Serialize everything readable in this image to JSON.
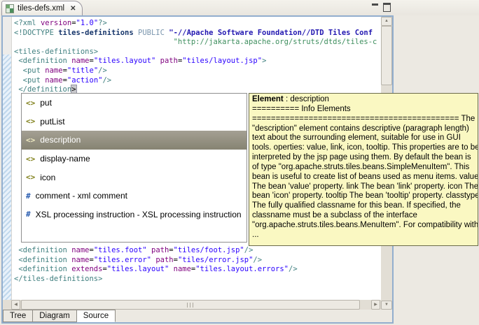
{
  "window": {
    "tab": {
      "title": "tiles-defs.xml",
      "close_glyph": "✕"
    }
  },
  "editor": {
    "lines_top": [
      [
        [
          "tag",
          "<?xml "
        ],
        [
          "attr",
          "version"
        ],
        [
          "pln",
          "="
        ],
        [
          "val",
          "\"1.0\""
        ],
        [
          "tag",
          "?>"
        ]
      ],
      [
        [
          "tag",
          "<!DOCTYPE "
        ],
        [
          "dtn",
          "tiles-definitions"
        ],
        [
          "pln",
          " "
        ],
        [
          "kw",
          "PUBLIC "
        ],
        [
          "pub",
          "\"-//Apache Software Foundation//DTD Tiles Conf"
        ]
      ],
      [
        [
          "pln",
          "                                    "
        ],
        [
          "sys",
          "\"http://jakarta.apache.org/struts/dtds/tiles-c"
        ]
      ],
      [
        [
          "tag",
          "<tiles-definitions>"
        ]
      ],
      [
        [
          "pln",
          " "
        ],
        [
          "tag",
          "<definition"
        ],
        [
          "attr",
          " name"
        ],
        [
          "pln",
          "="
        ],
        [
          "val",
          "\"tiles.layout\""
        ],
        [
          "attr",
          " path"
        ],
        [
          "pln",
          "="
        ],
        [
          "val",
          "\"tiles/layout.jsp\""
        ],
        [
          "tag",
          ">"
        ]
      ],
      [
        [
          "pln",
          "  "
        ],
        [
          "tag",
          "<put"
        ],
        [
          "attr",
          " name"
        ],
        [
          "pln",
          "="
        ],
        [
          "val",
          "\"title\""
        ],
        [
          "tag",
          "/>"
        ]
      ],
      [
        [
          "pln",
          "  "
        ],
        [
          "tag",
          "<put"
        ],
        [
          "attr",
          " name"
        ],
        [
          "pln",
          "="
        ],
        [
          "val",
          "\"action\""
        ],
        [
          "tag",
          "/>"
        ]
      ],
      [
        [
          "pln",
          " "
        ],
        [
          "tag",
          "</definition"
        ],
        [
          "hl",
          ">"
        ]
      ]
    ],
    "lines_bottom": [
      [
        [
          "pln",
          " "
        ],
        [
          "tag",
          "<definition"
        ],
        [
          "attr",
          " name"
        ],
        [
          "pln",
          "="
        ],
        [
          "val",
          "\"tiles.foot\""
        ],
        [
          "attr",
          " path"
        ],
        [
          "pln",
          "="
        ],
        [
          "val",
          "\"tiles/foot.jsp\""
        ],
        [
          "tag",
          "/>"
        ]
      ],
      [
        [
          "pln",
          " "
        ],
        [
          "tag",
          "<definition"
        ],
        [
          "attr",
          " name"
        ],
        [
          "pln",
          "="
        ],
        [
          "val",
          "\"tiles.error\""
        ],
        [
          "attr",
          " path"
        ],
        [
          "pln",
          "="
        ],
        [
          "val",
          "\"tiles/error.jsp\""
        ],
        [
          "tag",
          "/>"
        ]
      ],
      [
        [
          "pln",
          " "
        ],
        [
          "tag",
          "<definition"
        ],
        [
          "attr",
          " extends"
        ],
        [
          "pln",
          "="
        ],
        [
          "val",
          "\"tiles.layout\""
        ],
        [
          "attr",
          " name"
        ],
        [
          "pln",
          "="
        ],
        [
          "val",
          "\"tiles.layout.errors\""
        ],
        [
          "tag",
          "/>"
        ]
      ],
      [
        [
          "tag",
          "</tiles-definitions>"
        ]
      ]
    ]
  },
  "completion": {
    "icon_glyphs": {
      "element": "<>",
      "directive": "#"
    },
    "selected": "description",
    "items": [
      {
        "icon": "element",
        "label": "put",
        "selected": false
      },
      {
        "icon": "element",
        "label": "putList",
        "selected": false
      },
      {
        "icon": "element",
        "label": "description",
        "selected": true
      },
      {
        "icon": "element",
        "label": "display-name",
        "selected": false
      },
      {
        "icon": "element",
        "label": "icon",
        "selected": false
      },
      {
        "icon": "directive",
        "label": "comment - xml comment",
        "selected": false
      },
      {
        "icon": "directive",
        "label": "XSL processing instruction - XSL processing instruction",
        "selected": false
      }
    ]
  },
  "tooltip": {
    "title_label": "Element",
    "title_value": " : description",
    "lines": [
      "========== Info Elements",
      "============================================ The",
      "\"description\" element contains descriptive (paragraph length)",
      "text about the surrounding element, suitable for use in GUI",
      "tools. operties: value, link, icon, tooltip. This properties are to be",
      "interpreted by the jsp page using them. By default the bean is",
      "of type \"org.apache.struts.tiles.beans.SimpleMenuItem\". This",
      "bean is useful to create list of beans used as menu items. value",
      "The bean 'value' property. link The bean 'link' property. icon The",
      "bean 'icon' property. tooltip The bean 'tooltip' property. classtype",
      "The fully qualified classname for this bean. If specified, the",
      "classname must be a subclass of the interface",
      "\"org.apache.struts.tiles.beans.MenuItem\". For compatibility with",
      "..."
    ]
  },
  "page_tabs": {
    "active": "Source",
    "items": [
      {
        "label": "Tree"
      },
      {
        "label": "Diagram"
      },
      {
        "label": "Source"
      }
    ]
  },
  "scrollbar_icons": {
    "up": "▲",
    "down": "▼",
    "left": "◀",
    "right": "▶"
  },
  "colors": {
    "background": "#ECE9E2",
    "frame_highlight_border": "#92AECE",
    "tooltip_background": "#FAF8C2",
    "completion_selection": "#8F8C7E",
    "tag": "#3F7F7F",
    "attribute_name": "#7F007F",
    "attribute_value": "#2A00FF",
    "doctype_name": "#17366B",
    "doctype_keyword": "#7B96AE",
    "doctype_public_id": "#2318B1",
    "doctype_system_id": "#3F8F5F",
    "quickdiff_hatch": "#BFD7EC"
  }
}
